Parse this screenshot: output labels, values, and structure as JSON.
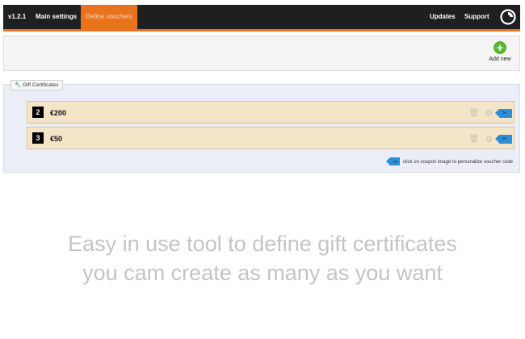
{
  "nav": {
    "version": "v1.2.1",
    "items": [
      {
        "label": "Main settings"
      },
      {
        "label": "Define vouchers",
        "active": true
      }
    ],
    "right_items": [
      {
        "label": "Updates"
      },
      {
        "label": "Support"
      }
    ]
  },
  "toolbar": {
    "add_new_label": "Add new"
  },
  "gift_certificates": {
    "legend": "Gift Certificates",
    "rows": [
      {
        "num": "2",
        "value": "€200"
      },
      {
        "num": "3",
        "value": "€50"
      }
    ],
    "hint": "click on coupon image to personalize voucher code"
  },
  "tagline": {
    "line1": "Easy in use tool to define gift certificates",
    "line2": "you cam create as many as you want"
  },
  "colors": {
    "accent": "#e8731c",
    "nav_bg": "#1f1f1f",
    "row_bg": "#f5e5c8",
    "panel_bg": "#ebeef7",
    "tag_blue": "#2b8ed6",
    "add_green": "#5bb52f"
  }
}
